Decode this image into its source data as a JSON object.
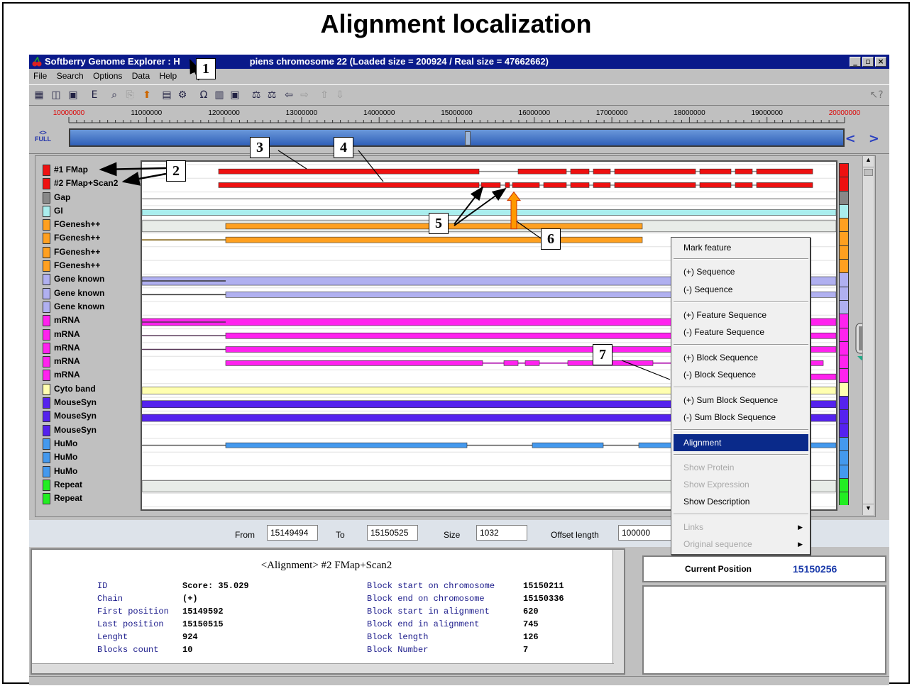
{
  "page_heading": "Alignment localization",
  "window": {
    "title": "Softberry Genome Explorer : H",
    "title_tail": "piens chromosome 22 (Loaded size = 200924 / Real size = 47662662)",
    "buttons": [
      "minimize-icon",
      "maximize-icon",
      "close-icon"
    ]
  },
  "menu": [
    "File",
    "Search",
    "Options",
    "Data",
    "Help"
  ],
  "toolbar_icons": [
    "view-icon",
    "split-icon",
    "window-icon",
    "export-icon",
    "zoom-find-icon",
    "copy-icon",
    "mark-icon",
    "calendar-icon",
    "settings-icon",
    "omega-icon",
    "grid-icon",
    "db-icon",
    "filter-a-icon",
    "filter-b-icon",
    "back-icon",
    "forward-icon",
    "up-icon",
    "down-icon",
    "help-icon"
  ],
  "ruler": {
    "ticks": [
      "10000000",
      "11000000",
      "12000000",
      "13000000",
      "14000000",
      "15000000",
      "16000000",
      "17000000",
      "18000000",
      "19000000",
      "20000000"
    ],
    "highlight_color": "#dd0000",
    "full_label": "FULL",
    "nav": "< >"
  },
  "tracks": [
    {
      "label": "#1 FMap",
      "color": "#ee1111"
    },
    {
      "label": "#2 FMap+Scan2",
      "color": "#ee1111"
    },
    {
      "label": "Gap",
      "color": "#888888"
    },
    {
      "label": "GI",
      "color": "#aaeeee"
    },
    {
      "label": "FGenesh++",
      "color": "#ffa020"
    },
    {
      "label": "FGenesh++",
      "color": "#ffa020"
    },
    {
      "label": "FGenesh++",
      "color": "#ffa020"
    },
    {
      "label": "FGenesh++",
      "color": "#ffa020"
    },
    {
      "label": "Gene known",
      "color": "#b0b0f0"
    },
    {
      "label": "Gene known",
      "color": "#b0b0f0"
    },
    {
      "label": "Gene known",
      "color": "#b0b0f0"
    },
    {
      "label": "mRNA",
      "color": "#ff22ee"
    },
    {
      "label": "mRNA",
      "color": "#ff22ee"
    },
    {
      "label": "mRNA",
      "color": "#ff22ee"
    },
    {
      "label": "mRNA",
      "color": "#ff22ee"
    },
    {
      "label": "mRNA",
      "color": "#ff22ee"
    },
    {
      "label": "Cyto band",
      "color": "#ffffb0"
    },
    {
      "label": "MouseSyn",
      "color": "#5522ee"
    },
    {
      "label": "MouseSyn",
      "color": "#5522ee"
    },
    {
      "label": "MouseSyn",
      "color": "#5522ee"
    },
    {
      "label": "HuMo",
      "color": "#4499ee"
    },
    {
      "label": "HuMo",
      "color": "#4499ee"
    },
    {
      "label": "HuMo",
      "color": "#4499ee"
    },
    {
      "label": "Repeat",
      "color": "#22ee22"
    },
    {
      "label": "Repeat",
      "color": "#22ee22"
    }
  ],
  "context_menu": {
    "mark_feature": "Mark feature",
    "plus_sequence": "(+) Sequence",
    "minus_sequence": "(-) Sequence",
    "plus_feature_sequence": "(+) Feature Sequence",
    "minus_feature_sequence": "(-) Feature Sequence",
    "plus_block_sequence": "(+) Block Sequence",
    "minus_block_sequence": "(-) Block Sequence",
    "plus_sum_block_sequence": "(+) Sum Block Sequence",
    "minus_sum_block_sequence": "(-) Sum Block Sequence",
    "alignment": "Alignment",
    "show_protein": "Show Protein",
    "show_expression": "Show Expression",
    "show_description": "Show Description",
    "links": "Links",
    "original_sequence": "Original sequence"
  },
  "range": {
    "from_label": "From",
    "from_value": "15149494",
    "to_label": "To",
    "to_value": "15150525",
    "size_label": "Size",
    "size_value": "1032",
    "offset_label": "Offset length",
    "offset_value": "100000"
  },
  "info": {
    "title": "<Alignment> #2 FMap+Scan2",
    "left": [
      {
        "k": "ID",
        "v": "Score: 35.029"
      },
      {
        "k": "Chain",
        "v": "(+)"
      },
      {
        "k": "First position",
        "v": "15149592"
      },
      {
        "k": "Last position",
        "v": "15150515"
      },
      {
        "k": "Lenght",
        "v": "924"
      },
      {
        "k": "Blocks count",
        "v": "10"
      }
    ],
    "right": [
      {
        "k": "Block start on chromosome",
        "v": "15150211"
      },
      {
        "k": "Block end on chromosome",
        "v": "15150336"
      },
      {
        "k": "Block start in alignment",
        "v": "620"
      },
      {
        "k": "Block end in alignment",
        "v": "745"
      },
      {
        "k": "Block length",
        "v": "126"
      },
      {
        "k": "Block Number",
        "v": "7"
      }
    ]
  },
  "current_position": {
    "label": "Current Position",
    "value": "15150256",
    "value_color": "#1a3aaa"
  },
  "callouts": [
    "1",
    "2",
    "3",
    "4",
    "5",
    "6",
    "7"
  ]
}
